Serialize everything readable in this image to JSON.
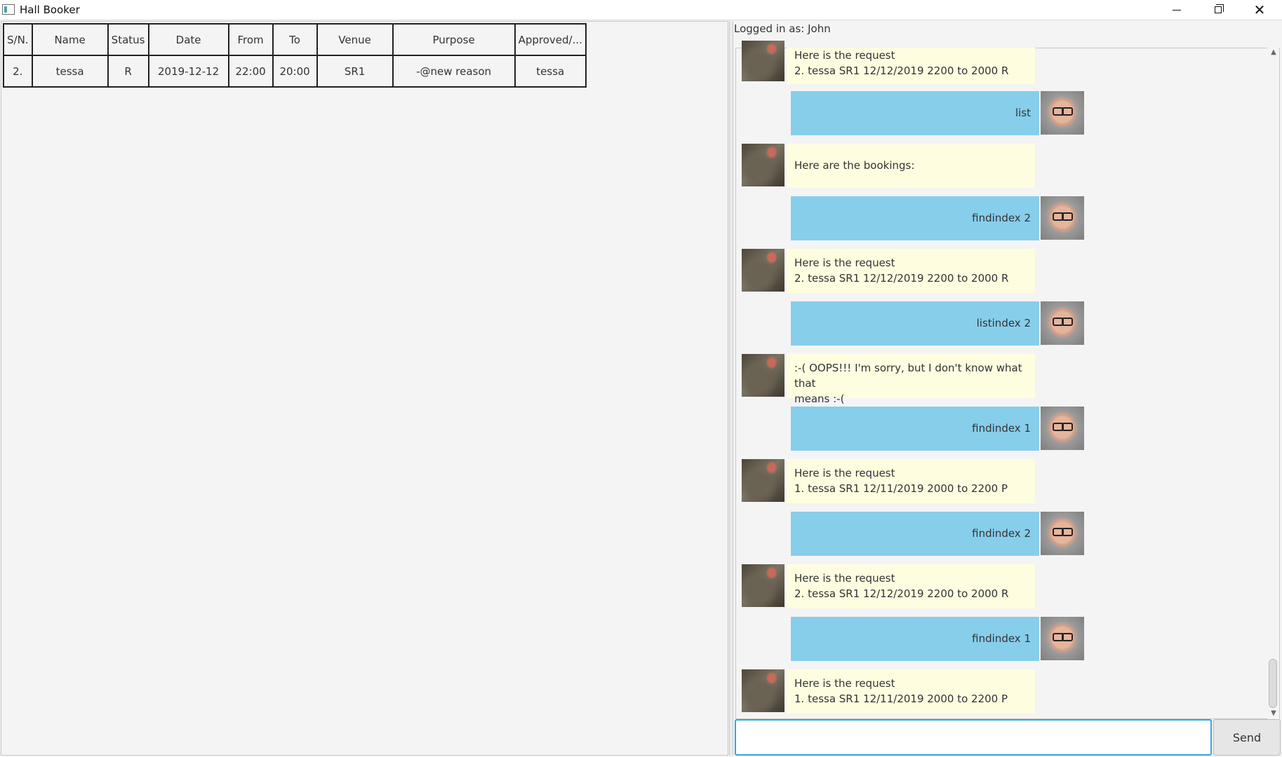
{
  "window": {
    "title": "Hall Booker",
    "minimize_icon": "minimize-icon",
    "maximize_icon": "restore-icon",
    "close_icon": "close-icon"
  },
  "table": {
    "columns": [
      "S/N.",
      "Name",
      "Status",
      "Date",
      "From",
      "To",
      "Venue",
      "Purpose",
      "Approved/..."
    ],
    "rows": [
      [
        "2.",
        "tessa",
        "R",
        "2019-12-12",
        "22:00",
        "20:00",
        "SR1",
        "-@new reason",
        "tessa"
      ]
    ]
  },
  "chat": {
    "logged_in": "Logged in as: John",
    "messages": [
      {
        "from": "duke",
        "lines": [
          "Here is the request",
          "2. tessa SR1 12/12/2019 2200 to 2000 R"
        ]
      },
      {
        "from": "user",
        "text": "list"
      },
      {
        "from": "duke",
        "lines": [
          "Here are the bookings:"
        ]
      },
      {
        "from": "user",
        "text": "findindex 2"
      },
      {
        "from": "duke",
        "lines": [
          "Here is the request",
          "2. tessa SR1 12/12/2019 2200 to 2000 R"
        ]
      },
      {
        "from": "user",
        "text": "listindex 2"
      },
      {
        "from": "duke",
        "lines": [
          ":-( OOPS!!! I'm sorry, but I don't know what that",
          "means :-("
        ]
      },
      {
        "from": "user",
        "text": "findindex 1"
      },
      {
        "from": "duke",
        "lines": [
          "Here is the request",
          "1. tessa SR1 12/11/2019 2000 to 2200 P"
        ]
      },
      {
        "from": "user",
        "text": "findindex 2"
      },
      {
        "from": "duke",
        "lines": [
          "Here is the request",
          "2. tessa SR1 12/12/2019 2200 to 2000 R"
        ]
      },
      {
        "from": "user",
        "text": "findindex 1"
      },
      {
        "from": "duke",
        "lines": [
          "Here is the request",
          "1. tessa SR1 12/11/2019 2000 to 2200 P"
        ]
      }
    ]
  },
  "input": {
    "value": "",
    "placeholder": ""
  },
  "send_label": "Send",
  "colors": {
    "user_bubble": "#87ceeb",
    "duke_bubble": "#fffde0",
    "input_focus": "#39a5dc"
  }
}
